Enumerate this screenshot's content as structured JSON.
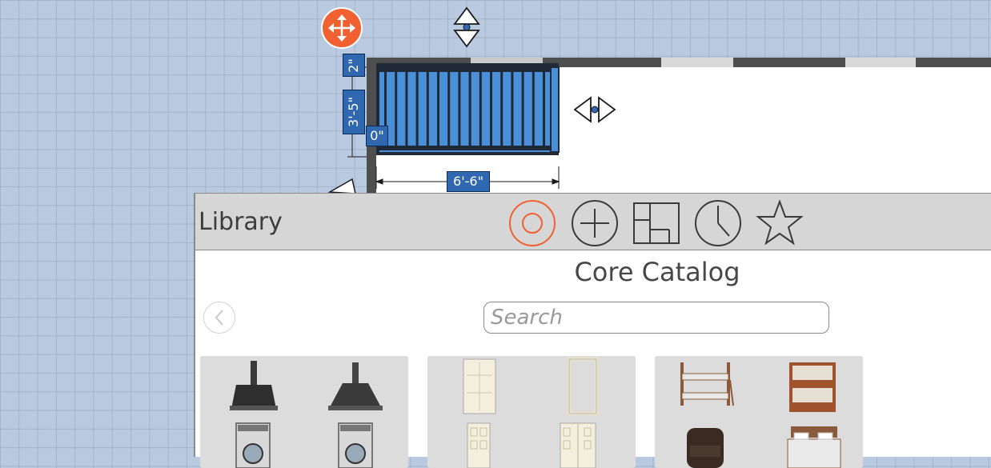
{
  "canvas": {
    "dimensions": {
      "wall_thickness": "2\"",
      "stair_depth": "3'-5\"",
      "offset": "0\"",
      "stair_width": "6'-6\""
    },
    "handles": {
      "move": "move-icon",
      "vertical_resize": "vertical-resize-icon",
      "horizontal_resize": "horizontal-resize-icon"
    }
  },
  "library": {
    "title": "Library",
    "tabs": [
      {
        "name": "Core Catalog",
        "icon": "target-icon",
        "active": true
      },
      {
        "name": "Add",
        "icon": "plus-circle-icon",
        "active": false
      },
      {
        "name": "Floor plan",
        "icon": "floorplan-icon",
        "active": false
      },
      {
        "name": "Recent",
        "icon": "clock-icon",
        "active": false
      },
      {
        "name": "Favorites",
        "icon": "star-icon",
        "active": false
      }
    ],
    "catalog_title": "Core Catalog",
    "search": {
      "placeholder": "Search",
      "value": ""
    },
    "categories": [
      {
        "name": "kitchen-appliances",
        "items": [
          "range-hood",
          "range-hood-chimney",
          "washing-machine",
          "washing-machine"
        ]
      },
      {
        "name": "doors",
        "items": [
          "door-panel",
          "door-frame",
          "door-single",
          "door-double"
        ]
      },
      {
        "name": "bedroom",
        "items": [
          "bunk-bed",
          "bunk-bed-wood",
          "sofa-dark",
          "bed-double"
        ]
      }
    ]
  },
  "colors": {
    "accent": "#f06030",
    "dimension_label": "#2f68b0",
    "stairs": "#4a90d9",
    "wall": "#4e4e4e",
    "grid_bg": "#b9c9df",
    "panel_header": "#d6d6d6"
  }
}
